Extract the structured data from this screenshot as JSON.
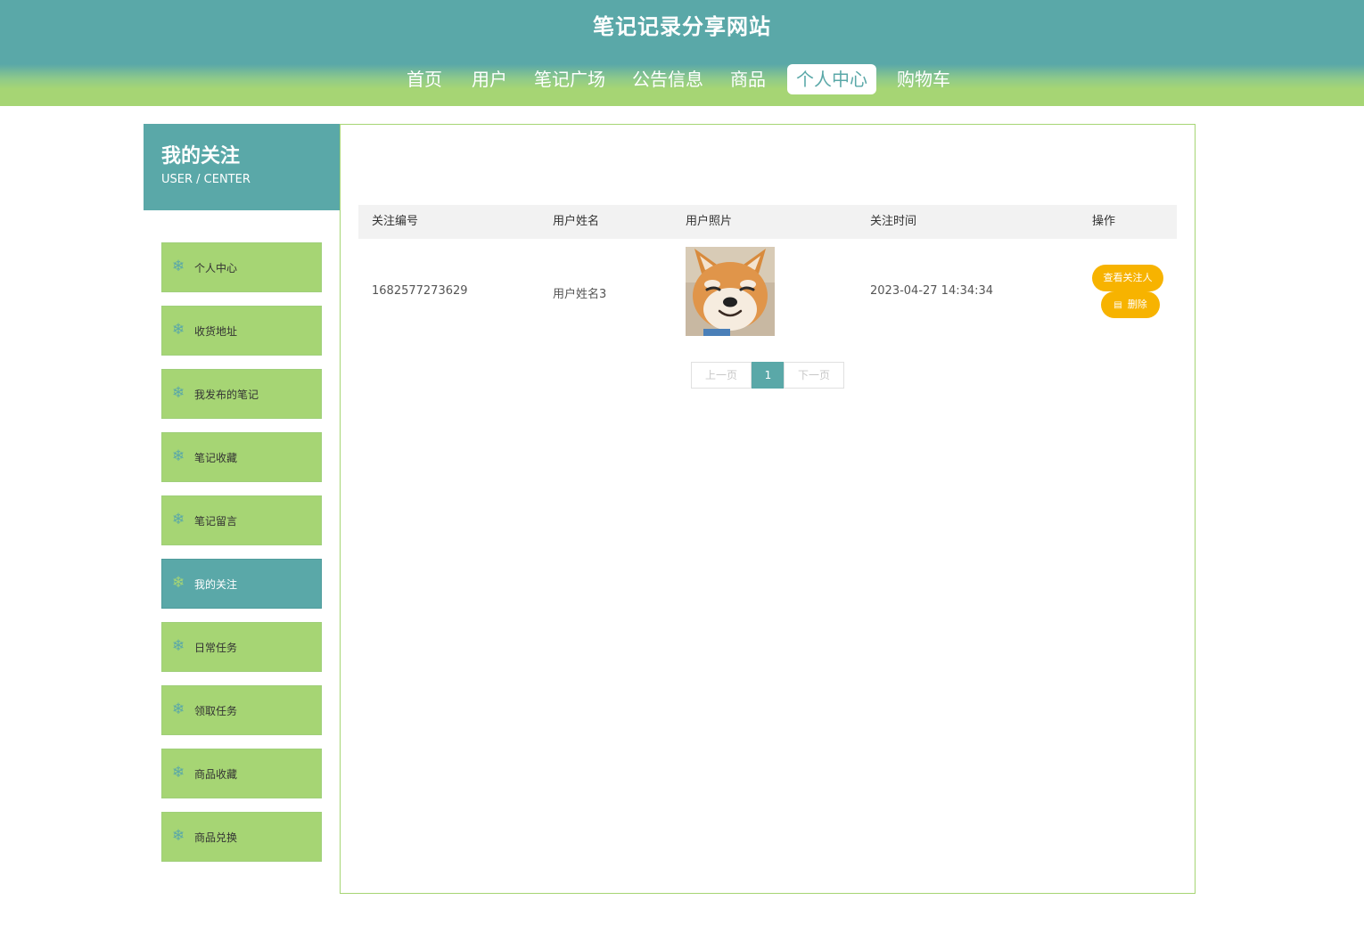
{
  "site": {
    "title": "笔记记录分享网站"
  },
  "nav": [
    {
      "label": "首页"
    },
    {
      "label": "用户"
    },
    {
      "label": "笔记广场"
    },
    {
      "label": "公告信息"
    },
    {
      "label": "商品"
    },
    {
      "label": "个人中心",
      "active": true
    },
    {
      "label": "购物车"
    }
  ],
  "sidebar": {
    "title": "我的关注",
    "subtitle": "USER / CENTER",
    "items": [
      {
        "label": "个人中心"
      },
      {
        "label": "收货地址"
      },
      {
        "label": "我发布的笔记"
      },
      {
        "label": "笔记收藏"
      },
      {
        "label": "笔记留言"
      },
      {
        "label": "我的关注",
        "active": true
      },
      {
        "label": "日常任务"
      },
      {
        "label": "领取任务"
      },
      {
        "label": "商品收藏"
      },
      {
        "label": "商品兑换"
      }
    ],
    "icon": "snowflake-icon"
  },
  "table": {
    "headers": [
      "关注编号",
      "用户姓名",
      "用户照片",
      "关注时间",
      "操作"
    ],
    "rows": [
      {
        "id": "1682577273629",
        "name": "用户姓名3",
        "photo": "shiba-dog-photo",
        "time": "2023-04-27 14:34:34",
        "view_label": "查看关注人",
        "delete_label": "删除"
      }
    ]
  },
  "pagination": {
    "prev": "上一页",
    "current": "1",
    "next": "下一页"
  },
  "colors": {
    "teal": "#5aa8a8",
    "green": "#a6d574",
    "orange": "#f7b300"
  }
}
